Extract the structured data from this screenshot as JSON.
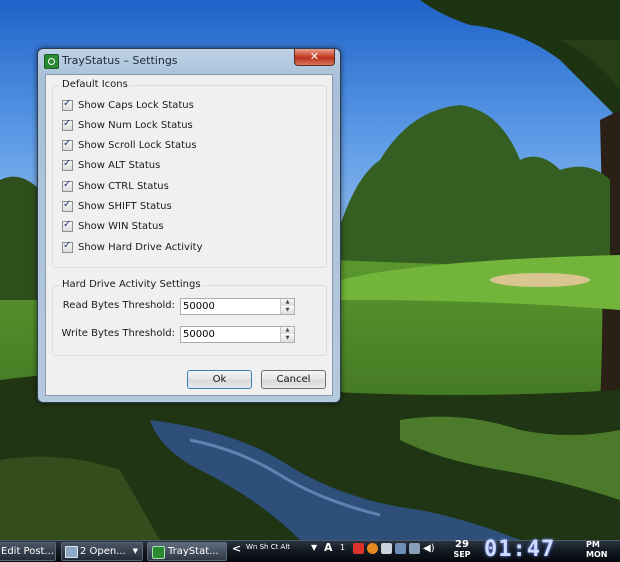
{
  "window": {
    "title": "TrayStatus – Settings",
    "close_glyph": "✕"
  },
  "default_icons": {
    "title": "Default Icons",
    "items": [
      {
        "label": "Show Caps Lock Status",
        "checked": true
      },
      {
        "label": "Show Num Lock Status",
        "checked": true
      },
      {
        "label": "Show Scroll Lock Status",
        "checked": true
      },
      {
        "label": "Show ALT Status",
        "checked": true
      },
      {
        "label": "Show CTRL Status",
        "checked": true
      },
      {
        "label": "Show SHIFT Status",
        "checked": true
      },
      {
        "label": "Show WIN Status",
        "checked": true
      },
      {
        "label": "Show Hard Drive Activity",
        "checked": true
      }
    ]
  },
  "hd_settings": {
    "title": "Hard Drive Activity Settings",
    "read_label": "Read Bytes Threshold:",
    "read_value": "50000",
    "write_label": "Write Bytes Threshold:",
    "write_value": "50000"
  },
  "buttons": {
    "ok": "Ok",
    "cancel": "Cancel"
  },
  "taskbar": {
    "tasks": [
      {
        "label": "Edit Post..."
      },
      {
        "label": "2 Open..."
      },
      {
        "label": "TrayStat..."
      }
    ],
    "tray": {
      "collapse": "<",
      "lock_indicators": "Wn Sh Ct Alt",
      "menu_arrow": "▼",
      "font_icon": "A",
      "number_icon": "1"
    },
    "clock": {
      "day": "29",
      "month": "SEP",
      "time": "01:47",
      "ampm": "PM",
      "weekday": "MON"
    }
  },
  "colors": {
    "close_button": "#c9462d",
    "checkmark": "#1e3c75",
    "taskbar": "#121821",
    "clock_text": "#d0dcff"
  }
}
